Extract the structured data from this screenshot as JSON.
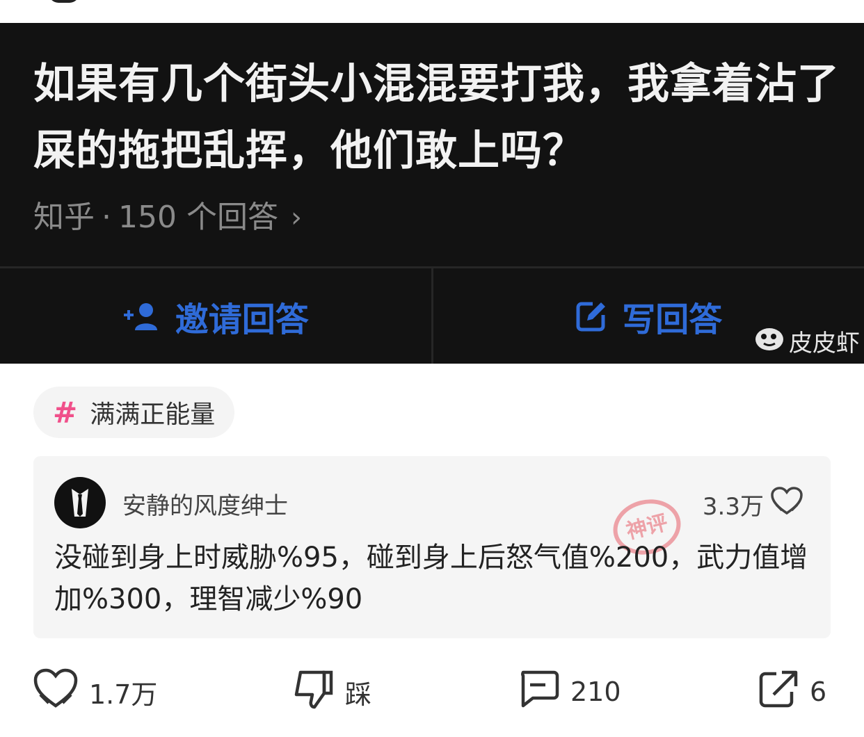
{
  "question": {
    "title": "如果有几个街头小混混要打我，我拿着沾了屎的拖把乱挥，他们敢上吗？",
    "source": "知乎",
    "answer_count": "150 个回答"
  },
  "actions": {
    "invite_label": "邀请回答",
    "write_label": "写回答"
  },
  "watermark": "皮皮虾",
  "topic": {
    "hash": "#",
    "label": "满满正能量"
  },
  "comment": {
    "username": "安静的风度绅士",
    "likes": "3.3万",
    "stamp_text": "神评",
    "text": "没碰到身上时威胁%95，碰到身上后怒气值%200，武力值增加%300，理智减少%90"
  },
  "bottom_bar": {
    "likes": "1.7万",
    "dislike_label": "踩",
    "comments": "210",
    "shares": "6"
  },
  "colors": {
    "accent_blue": "#2f6bd8",
    "topic_pink": "#f0508a",
    "stamp_red": "#e8606a"
  },
  "icons": [
    "person-add-icon",
    "edit-icon",
    "shrimp-logo-icon",
    "hashtag-icon",
    "heart-hands-icon",
    "thumbs-down-icon",
    "comment-icon",
    "share-icon"
  ]
}
